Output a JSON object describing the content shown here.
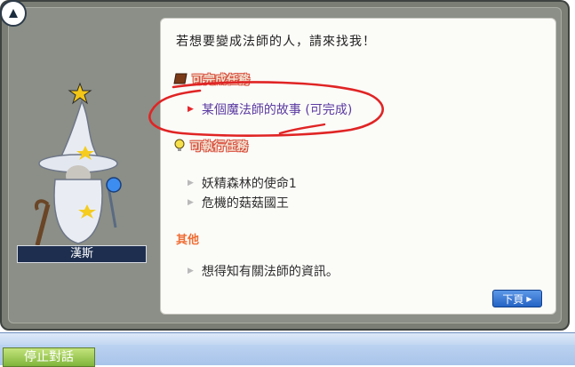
{
  "dialog": {
    "greeting": "若想要變成法師的人，請來找我！",
    "npc_name": "漢斯",
    "sections": [
      {
        "title": "可完成任務",
        "icon": "book-icon",
        "items": [
          "某個魔法師的故事 (可完成)"
        ]
      },
      {
        "title": "可執行任務",
        "icon": "lightbulb-icon",
        "items": [
          "妖精森林的使命1",
          "危機的菇菇國王"
        ]
      },
      {
        "title": "其他",
        "items": [
          "想得知有關法師的資訊。"
        ]
      }
    ],
    "next_label": "下頁",
    "annotation_color": "#e02424"
  },
  "footer": {
    "end_chat_label": "停止對話"
  }
}
